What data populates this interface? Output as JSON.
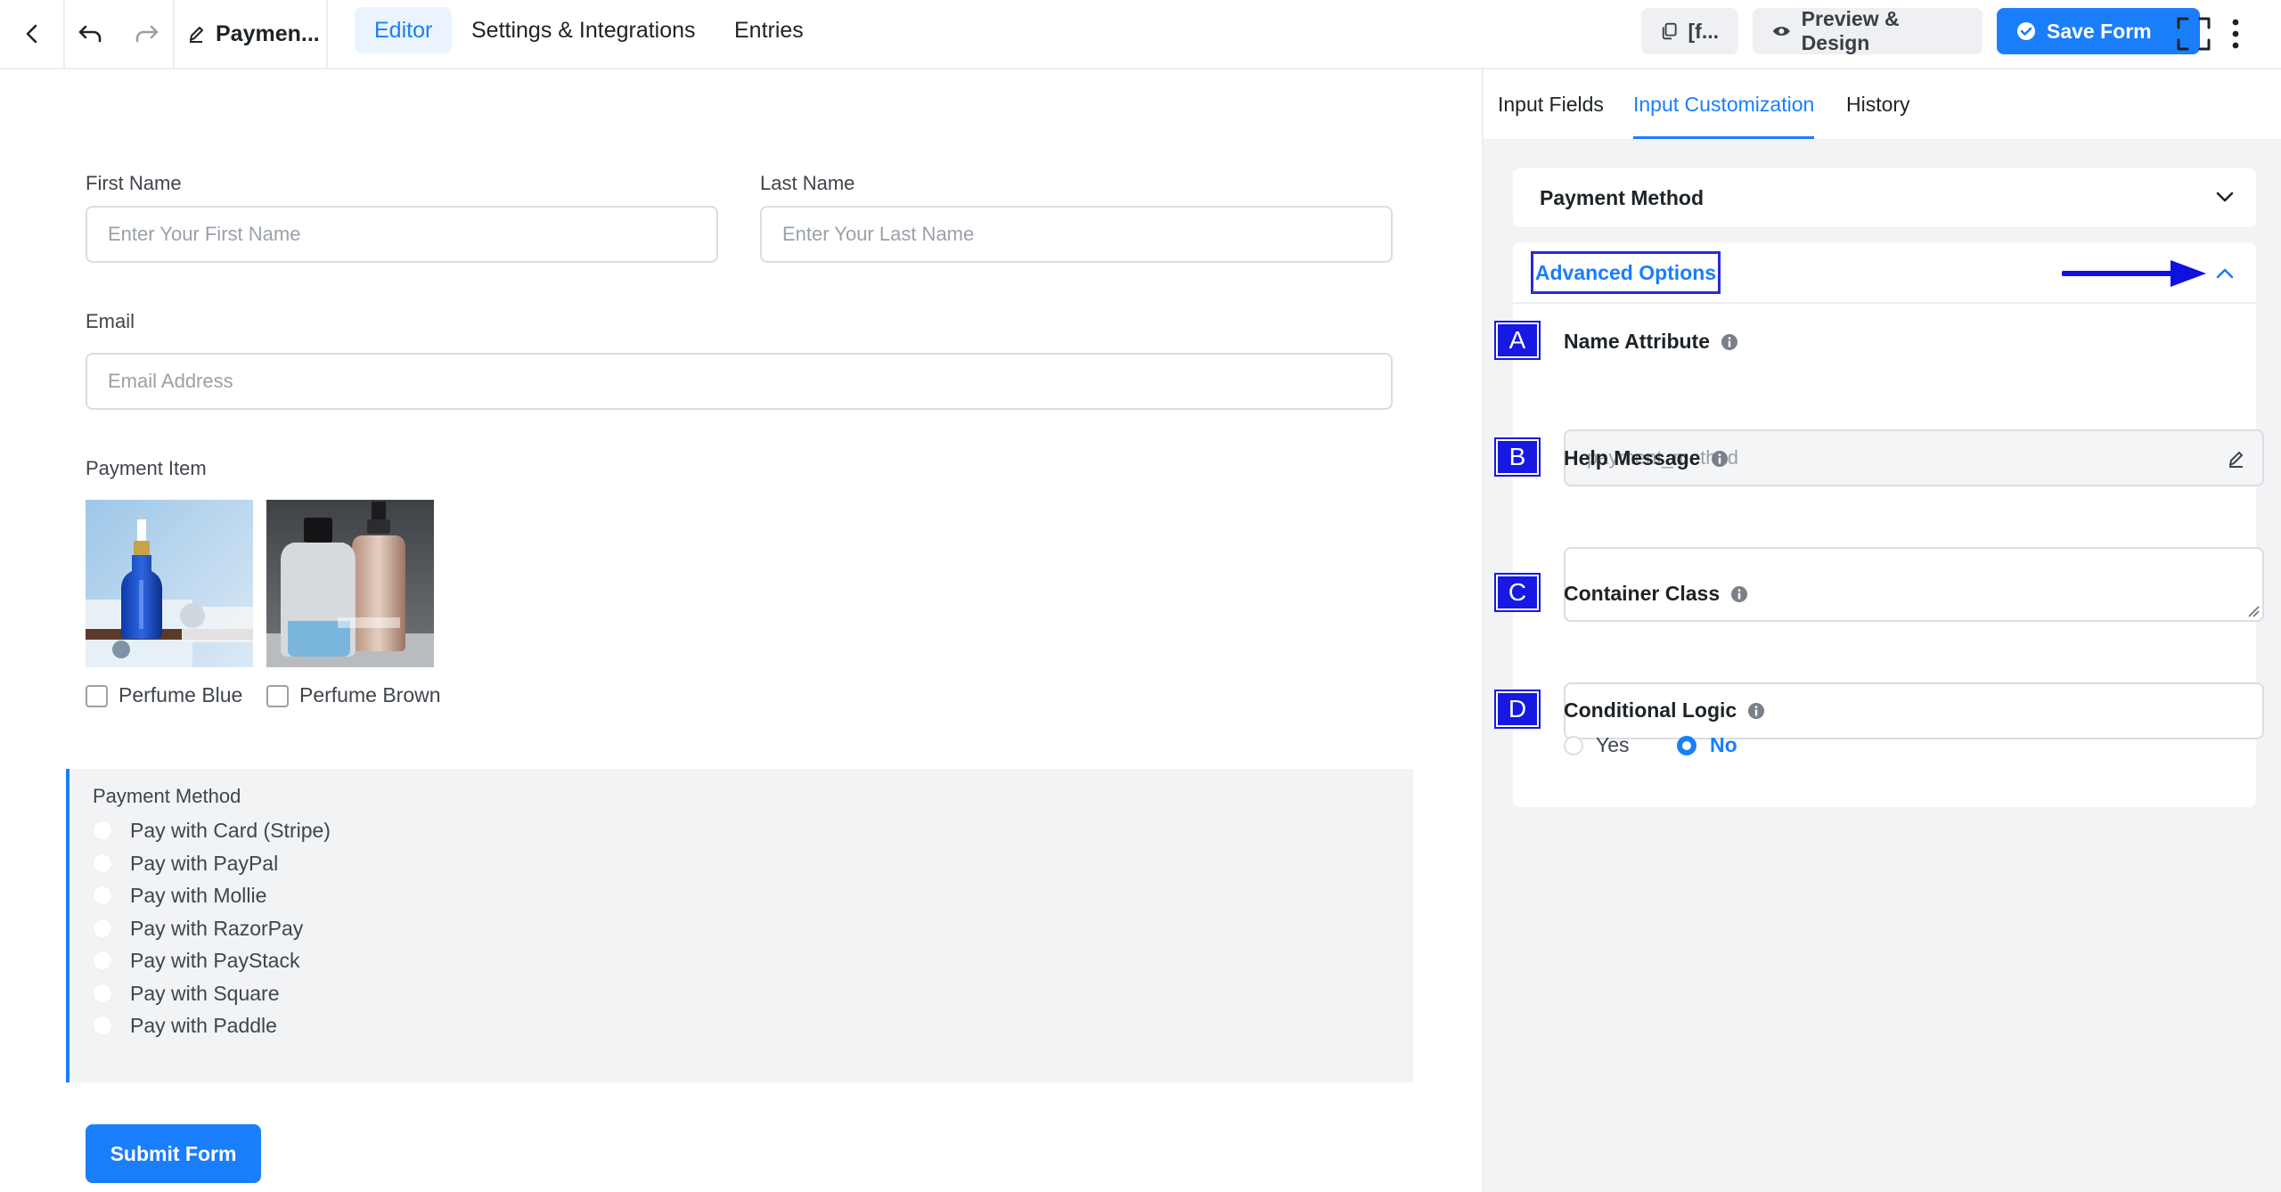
{
  "colors": {
    "accent": "#1a7efb",
    "annotation": "#1818e3"
  },
  "topbar": {
    "back_icon": "chevron-left-icon",
    "undo_icon": "undo-icon",
    "redo_icon": "redo-icon",
    "form_name": "Paymen...",
    "tabs": [
      {
        "label": "Editor",
        "active": true
      },
      {
        "label": "Settings & Integrations",
        "active": false
      },
      {
        "label": "Entries",
        "active": false
      }
    ],
    "shortcode_label": "[f...",
    "preview_label": "Preview & Design",
    "save_label": "Save Form"
  },
  "form": {
    "first_name": {
      "label": "First Name",
      "placeholder": "Enter Your First Name"
    },
    "last_name": {
      "label": "Last Name",
      "placeholder": "Enter Your Last Name"
    },
    "email": {
      "label": "Email",
      "placeholder": "Email Address"
    },
    "payment_item": {
      "label": "Payment Item",
      "items": [
        {
          "label": "Perfume Blue",
          "checked": false
        },
        {
          "label": "Perfume Brown",
          "checked": false
        }
      ]
    },
    "payment_method": {
      "label": "Payment Method",
      "options": [
        "Pay with Card (Stripe)",
        "Pay with PayPal",
        "Pay with Mollie",
        "Pay with RazorPay",
        "Pay with PayStack",
        "Pay with Square",
        "Pay with Paddle"
      ]
    },
    "submit_label": "Submit Form"
  },
  "sidebar": {
    "tabs": [
      {
        "label": "Input Fields",
        "active": false
      },
      {
        "label": "Input Customization",
        "active": true
      },
      {
        "label": "History",
        "active": false
      }
    ],
    "payment_method_section": "Payment Method",
    "advanced_options": {
      "title": "Advanced Options",
      "expanded": true,
      "name_attribute": {
        "marker": "A",
        "label": "Name Attribute",
        "value": "payment_method"
      },
      "help_message": {
        "marker": "B",
        "label": "Help Message",
        "value": ""
      },
      "container_class": {
        "marker": "C",
        "label": "Container Class",
        "value": ""
      },
      "conditional_logic": {
        "marker": "D",
        "label": "Conditional Logic",
        "options": [
          "Yes",
          "No"
        ],
        "selected": "No"
      }
    }
  }
}
